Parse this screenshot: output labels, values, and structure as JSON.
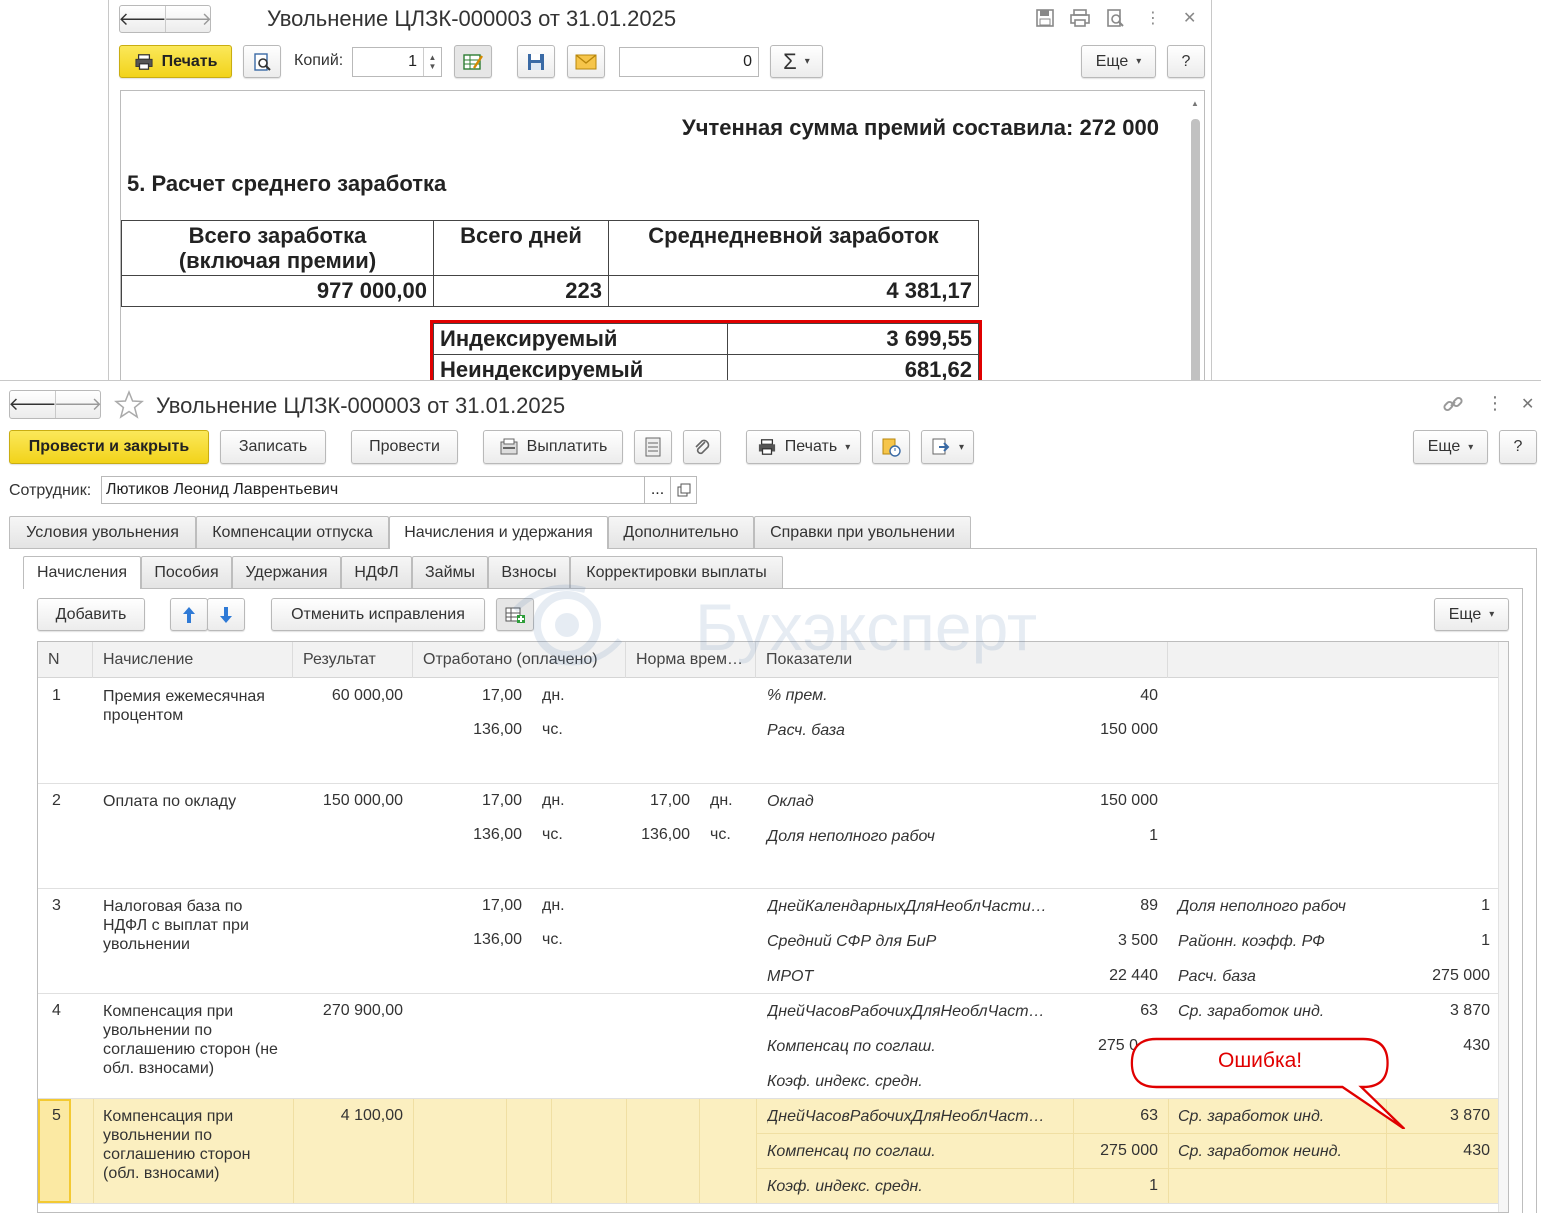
{
  "top_window": {
    "title": "Увольнение ЦЛЗК-000003 от 31.01.2025",
    "print_label": "Печать",
    "copies_label": "Копий:",
    "copies_value": "1",
    "sum_value": "0",
    "more_label": "Еще",
    "help_label": "?",
    "report": {
      "bonus_line": "Учтенная сумма премий составила: 272 000",
      "section_title": "5. Расчет среднего  заработка",
      "table_headers": [
        "Всего заработка",
        "(включая премии)",
        "Всего дней",
        "Среднедневной заработок"
      ],
      "table_values": [
        "977 000,00",
        "223",
        "4 381,17"
      ],
      "indexed_label": "Индексируемый",
      "indexed_value": "3 699,55",
      "nonindexed_label": "Неиндексируемый",
      "nonindexed_value": "681,62"
    }
  },
  "bottom_window": {
    "title": "Увольнение ЦЛЗК-000003 от 31.01.2025",
    "toolbar": {
      "post_close": "Провести и закрыть",
      "save": "Записать",
      "post": "Провести",
      "pay": "Выплатить",
      "print": "Печать",
      "more": "Еще",
      "help": "?"
    },
    "employee_label": "Сотрудник:",
    "employee_value": "Лютиков Леонид Лаврентьевич",
    "employee_btn": "...",
    "tabs": [
      "Условия увольнения",
      "Компенсации отпуска",
      "Начисления и удержания",
      "Дополнительно",
      "Справки при увольнении"
    ],
    "subtabs": [
      "Начисления",
      "Пособия",
      "Удержания",
      "НДФЛ",
      "Займы",
      "Взносы",
      "Корректировки выплаты"
    ],
    "grid_toolbar": {
      "add": "Добавить",
      "cancel_fix": "Отменить исправления",
      "more": "Еще"
    },
    "columns": [
      "N",
      "Начисление",
      "Результат",
      "Отработано (оплачено)",
      "Норма врем…",
      "Показатели"
    ],
    "rows": [
      {
        "n": "1",
        "name": "Премия ежемесячная процентом",
        "result": "60 000,00",
        "worked": [
          [
            "17,00",
            "дн."
          ],
          [
            "136,00",
            "чс."
          ]
        ],
        "norm": [],
        "ind1": [
          [
            "% прем.",
            "40"
          ],
          [
            "Расч. база",
            "150 000"
          ]
        ],
        "ind2": []
      },
      {
        "n": "2",
        "name": "Оплата по окладу",
        "result": "150 000,00",
        "worked": [
          [
            "17,00",
            "дн."
          ],
          [
            "136,00",
            "чс."
          ]
        ],
        "norm": [
          [
            "17,00",
            "дн."
          ],
          [
            "136,00",
            "чс."
          ]
        ],
        "ind1": [
          [
            "Оклад",
            "150 000"
          ],
          [
            "Доля неполного рабоч",
            "1"
          ]
        ],
        "ind2": []
      },
      {
        "n": "3",
        "name": "Налоговая база по НДФЛ с выплат при увольнении",
        "result": "",
        "worked": [
          [
            "17,00",
            "дн."
          ],
          [
            "136,00",
            "чс."
          ]
        ],
        "norm": [],
        "ind1": [
          [
            "ДнейКалендарныхДляНеоблЧасти…",
            "89"
          ],
          [
            "Средний СФР для БиР",
            "3 500"
          ],
          [
            "МРОТ",
            "22 440"
          ]
        ],
        "ind2": [
          [
            "Доля неполного рабоч",
            "1"
          ],
          [
            "Районн. коэфф. РФ",
            "1"
          ],
          [
            "Расч. база",
            "275 000"
          ]
        ]
      },
      {
        "n": "4",
        "name": "Компенсация при увольнении по соглашению сторон (не обл. взносами)",
        "result": "270 900,00",
        "worked": [],
        "norm": [],
        "ind1": [
          [
            "ДнейЧасовРабочихДляНеоблЧаст…",
            "63"
          ],
          [
            "Компенсац по соглаш.",
            "275 0"
          ],
          [
            "Коэф. индекс. средн.",
            ""
          ]
        ],
        "ind2": [
          [
            "Ср. заработок инд.",
            "3 870"
          ],
          [
            "",
            "430"
          ]
        ]
      },
      {
        "n": "5",
        "name": "Компенсация при увольнении по соглашению сторон (обл. взносами)",
        "result": "4 100,00",
        "worked": [],
        "norm": [],
        "ind1": [
          [
            "ДнейЧасовРабочихДляНеоблЧаст…",
            "63"
          ],
          [
            "Компенсац по соглаш.",
            "275 000"
          ],
          [
            "Коэф. индекс. средн.",
            "1"
          ]
        ],
        "ind2": [
          [
            "Ср. заработок инд.",
            "3 870"
          ],
          [
            "Ср. заработок неинд.",
            "430"
          ]
        ]
      }
    ]
  },
  "callout_text": "Ошибка!",
  "watermark_text": "Бухэксперт",
  "colors": {
    "accent_yellow": "#f2d31a",
    "error_red": "#e00000",
    "selected_row": "#fbefc0"
  }
}
